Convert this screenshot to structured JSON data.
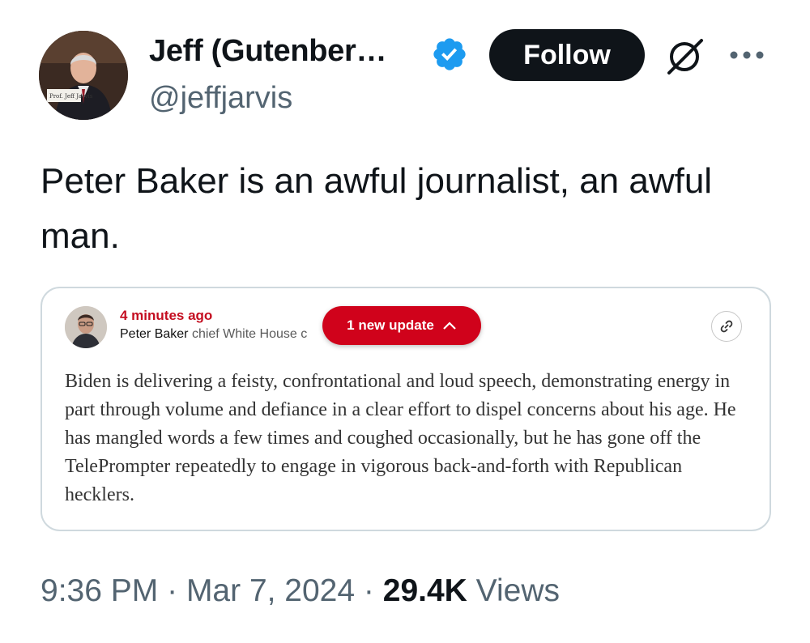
{
  "author": {
    "display_name": "Jeff (Gutenber…",
    "handle": "@jeffjarvis",
    "avatar_caption": "Prof. Jeff Jarvis",
    "verified_color": "#1d9bf0"
  },
  "actions": {
    "follow_label": "Follow",
    "grok_icon": "grok-icon",
    "more_icon": "more-icon"
  },
  "tweet": {
    "text": "Peter Baker is an awful journalist, an awful man."
  },
  "quote_card": {
    "time_ago": "4 minutes ago",
    "author_name": "Peter Baker",
    "author_role": "chief White House c",
    "update_label": "1 new update",
    "body": "Biden is delivering a feisty, confrontational and loud speech, demonstrating energy in part through volume and defiance in a clear effort to dispel concerns about his age. He has mangled words a few times and coughed occasionally, but he has gone off the TelePrompter repeatedly to engage in vigorous back-and-forth with Republican hecklers.",
    "accent_color": "#d0021b"
  },
  "meta": {
    "time": "9:36 PM",
    "separator": "·",
    "date": "Mar 7, 2024",
    "views_count": "29.4K",
    "views_label": "Views"
  }
}
